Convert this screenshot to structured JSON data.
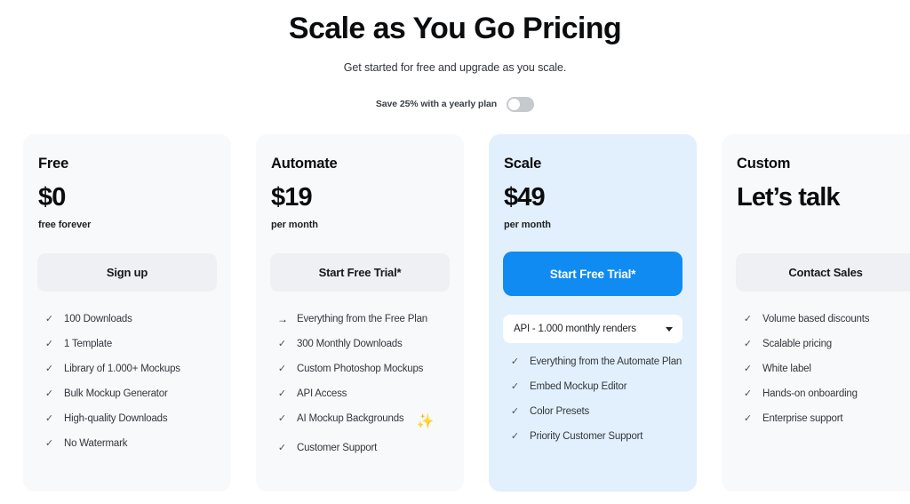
{
  "header": {
    "title": "Scale as You Go Pricing",
    "subtitle": "Get started for free and upgrade as you scale.",
    "billing_toggle_label": "Save 25% with a yearly plan",
    "billing_toggle_state": "off"
  },
  "colors": {
    "page_background": "#ffffff",
    "card_background": "#f8f9fb",
    "featured_card_background": "#e2f0fd",
    "primary_button": "#0f8bf2",
    "secondary_button": "#eef0f3",
    "text_primary": "#0b0c0e",
    "text_secondary": "#33373d",
    "toggle_track": "#c6c9cd",
    "sparkle": "#f5a623"
  },
  "plans": [
    {
      "name": "Free",
      "price": "$0",
      "period": "free forever",
      "cta": "Sign up",
      "cta_style": "secondary",
      "featured": false,
      "features": [
        {
          "icon": "check-icon",
          "glyph": "✓",
          "text": "100 Downloads"
        },
        {
          "icon": "check-icon",
          "glyph": "✓",
          "text": "1 Template"
        },
        {
          "icon": "check-icon",
          "glyph": "✓",
          "text": "Library of 1.000+ Mockups"
        },
        {
          "icon": "check-icon",
          "glyph": "✓",
          "text": "Bulk Mockup Generator"
        },
        {
          "icon": "check-icon",
          "glyph": "✓",
          "text": "High-quality Downloads"
        },
        {
          "icon": "check-icon",
          "glyph": "✓",
          "text": "No Watermark"
        }
      ]
    },
    {
      "name": "Automate",
      "price": "$19",
      "period": "per month",
      "cta": "Start Free Trial*",
      "cta_style": "secondary",
      "featured": false,
      "features": [
        {
          "icon": "arrow-right-icon",
          "glyph": "→",
          "text": "Everything from the Free Plan"
        },
        {
          "icon": "check-icon",
          "glyph": "✓",
          "text": "300 Monthly Downloads"
        },
        {
          "icon": "check-icon",
          "glyph": "✓",
          "text": "Custom Photoshop Mockups"
        },
        {
          "icon": "check-icon",
          "glyph": "✓",
          "text": "API Access"
        },
        {
          "icon": "check-icon",
          "glyph": "✓",
          "text": "AI Mockup Backgrounds",
          "sparkle": "✨"
        },
        {
          "icon": "check-icon",
          "glyph": "✓",
          "text": "Customer Support"
        }
      ]
    },
    {
      "name": "Scale",
      "price": "$49",
      "period": "per month",
      "cta": "Start Free Trial*",
      "cta_style": "primary",
      "featured": true,
      "select": {
        "value": "API - 1.000 monthly renders",
        "options": [
          "API - 1.000 monthly renders"
        ]
      },
      "features": [
        {
          "icon": "check-icon",
          "glyph": "✓",
          "text": "Everything from the Automate Plan"
        },
        {
          "icon": "check-icon",
          "glyph": "✓",
          "text": "Embed Mockup Editor"
        },
        {
          "icon": "check-icon",
          "glyph": "✓",
          "text": "Color Presets"
        },
        {
          "icon": "check-icon",
          "glyph": "✓",
          "text": "Priority Customer Support"
        }
      ]
    },
    {
      "name": "Custom",
      "price": "Let’s talk",
      "period": "",
      "cta": "Contact Sales",
      "cta_style": "secondary",
      "featured": false,
      "features": [
        {
          "icon": "check-icon",
          "glyph": "✓",
          "text": "Volume based discounts"
        },
        {
          "icon": "check-icon",
          "glyph": "✓",
          "text": "Scalable pricing"
        },
        {
          "icon": "check-icon",
          "glyph": "✓",
          "text": "White label"
        },
        {
          "icon": "check-icon",
          "glyph": "✓",
          "text": "Hands-on onboarding"
        },
        {
          "icon": "check-icon",
          "glyph": "✓",
          "text": "Enterprise support"
        }
      ]
    }
  ]
}
